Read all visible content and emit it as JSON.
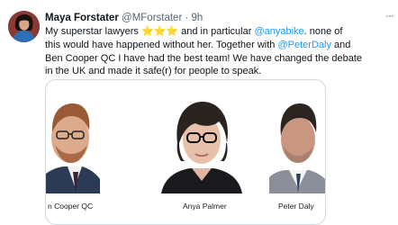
{
  "author": {
    "name": "Maya Forstater",
    "handle": "@MForstater",
    "separator": "·",
    "time": "9h"
  },
  "more_icon": "more-dots-icon",
  "tweet": {
    "line1_a": "My superstar lawyers ",
    "stars": "⭐⭐⭐",
    "line1_b": " and in particular ",
    "mention1": "@anyabike",
    "line1_c": ". none of",
    "line2_a": "this would have happened without her. Together with ",
    "mention2": "@PeterDaly",
    "line2_b": " and",
    "line3": "Ben Cooper QC I have had the best team! We have changed the debate",
    "line4": "in the UK and made it safe(r) for people to speak."
  },
  "media": {
    "captions": [
      "n Cooper QC",
      "Anya Palmer",
      "Peter Daly"
    ]
  },
  "colors": {
    "mention": "#1d9bf0",
    "text": "#0f1419",
    "secondary": "#536471"
  }
}
